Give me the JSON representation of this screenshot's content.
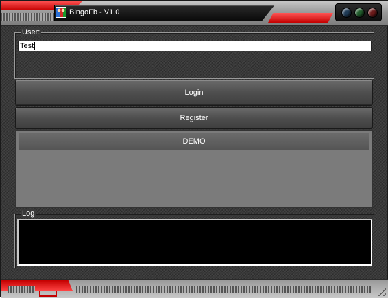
{
  "window": {
    "title": "BingoFb - V1.0",
    "icon": "app-people-icon",
    "accent_color": "#d40000",
    "controls": [
      "minimize-button",
      "maximize-button",
      "close-button"
    ]
  },
  "user_group": {
    "legend": "User:",
    "username_value": "Test"
  },
  "buttons": {
    "login_label": "Login",
    "register_label": "Register",
    "demo_label": "DEMO"
  },
  "log_group": {
    "legend": "Log",
    "content": ""
  }
}
